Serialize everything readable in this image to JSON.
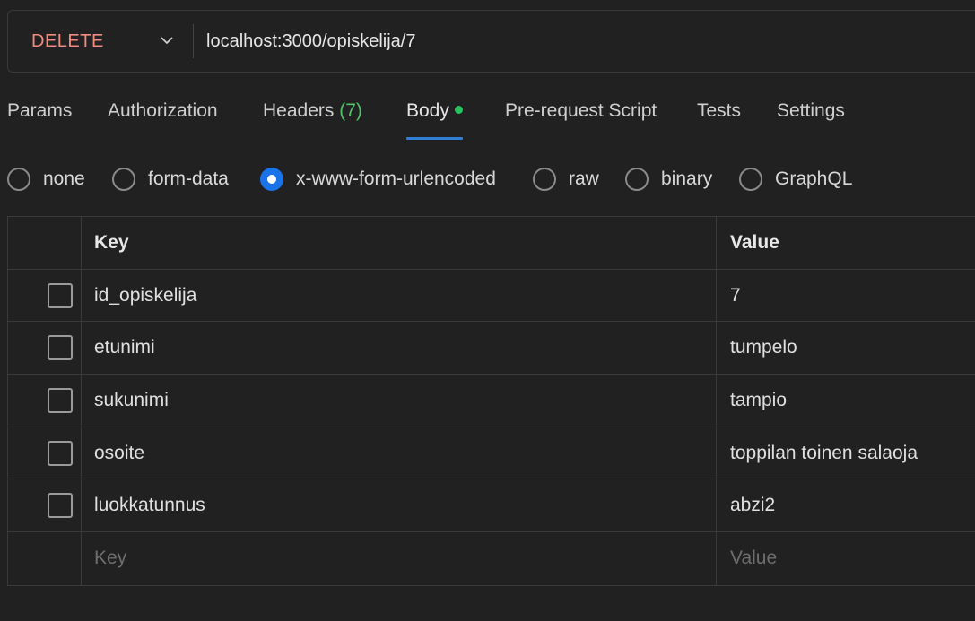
{
  "request": {
    "method": "DELETE",
    "url": "localhost:3000/opiskelija/7",
    "method_color": "#f08c7e"
  },
  "tabs": [
    {
      "label": "Params"
    },
    {
      "label": "Authorization"
    },
    {
      "label": "Headers",
      "count": "(7)"
    },
    {
      "label": "Body",
      "active": true,
      "indicator": "green-dot"
    },
    {
      "label": "Pre-request Script"
    },
    {
      "label": "Tests"
    },
    {
      "label": "Settings"
    }
  ],
  "body_types": [
    {
      "label": "none"
    },
    {
      "label": "form-data"
    },
    {
      "label": "x-www-form-urlencoded",
      "selected": true
    },
    {
      "label": "raw"
    },
    {
      "label": "binary"
    },
    {
      "label": "GraphQL"
    }
  ],
  "table": {
    "headers": {
      "key": "Key",
      "value": "Value"
    },
    "rows": [
      {
        "key": "id_opiskelija",
        "value": "7"
      },
      {
        "key": "etunimi",
        "value": "tumpelo"
      },
      {
        "key": "sukunimi",
        "value": "tampio"
      },
      {
        "key": "osoite",
        "value": "toppilan toinen salaoja"
      },
      {
        "key": "luokkatunnus",
        "value": "abzi2"
      }
    ],
    "new_row": {
      "key_placeholder": "Key",
      "value_placeholder": "Value"
    }
  },
  "colors": {
    "background": "#212121",
    "accent": "#1a73e8",
    "active_tab_underline": "#2f7fd6",
    "headers_count": "#4fc46b",
    "body_dot": "#22c55e"
  }
}
